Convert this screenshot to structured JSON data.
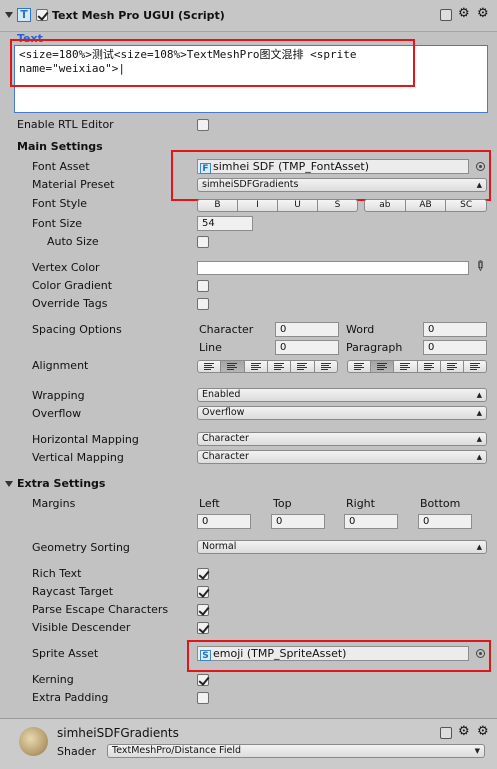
{
  "component": {
    "title": "Text Mesh Pro UGUI (Script)",
    "text_label": "Text",
    "text_value": "<size=180%>测试<size=108%>TextMeshPro图文混排 <sprite\nname=\"weixiao\">|"
  },
  "labels": {
    "enable_rtl": "Enable RTL Editor",
    "main_settings": "Main Settings",
    "font_asset": "Font Asset",
    "material_preset": "Material Preset",
    "font_style": "Font Style",
    "font_size": "Font Size",
    "auto_size": "Auto Size",
    "vertex_color": "Vertex Color",
    "color_gradient": "Color Gradient",
    "override_tags": "Override Tags",
    "spacing_options": "Spacing Options",
    "character": "Character",
    "word": "Word",
    "line": "Line",
    "paragraph": "Paragraph",
    "alignment": "Alignment",
    "wrapping": "Wrapping",
    "overflow": "Overflow",
    "horizontal_mapping": "Horizontal Mapping",
    "vertical_mapping": "Vertical Mapping",
    "extra_settings": "Extra Settings",
    "margins": "Margins",
    "left": "Left",
    "top": "Top",
    "right": "Right",
    "bottom": "Bottom",
    "geometry_sorting": "Geometry Sorting",
    "rich_text": "Rich Text",
    "raycast_target": "Raycast Target",
    "parse_escape": "Parse Escape Characters",
    "visible_descender": "Visible Descender",
    "sprite_asset": "Sprite Asset",
    "kerning": "Kerning",
    "extra_padding": "Extra Padding",
    "shader": "Shader"
  },
  "values": {
    "font_asset": "simhei SDF (TMP_FontAsset)",
    "material_preset": "simheiSDFGradients",
    "font_size": "54",
    "spacing_character": "0",
    "spacing_word": "0",
    "spacing_line": "0",
    "spacing_paragraph": "0",
    "wrapping": "Enabled",
    "overflow": "Overflow",
    "horizontal_mapping": "Character",
    "vertical_mapping": "Character",
    "margin_left": "0",
    "margin_top": "0",
    "margin_right": "0",
    "margin_bottom": "0",
    "geometry_sorting": "Normal",
    "sprite_asset": "emoji (TMP_SpriteAsset)",
    "material_name": "simheiSDFGradients",
    "shader": "TextMeshPro/Distance Field"
  },
  "font_style_buttons": [
    "B",
    "I",
    "U",
    "S",
    "ab",
    "AB",
    "SC"
  ],
  "checkboxes": {
    "enable_rtl": false,
    "auto_size": false,
    "color_gradient": false,
    "override_tags": false,
    "rich_text": true,
    "raycast_target": true,
    "parse_escape": true,
    "visible_descender": true,
    "kerning": true,
    "extra_padding": false,
    "component_enabled": true
  },
  "colors": {
    "panel_bg": "#c2c2c2",
    "highlight_red": "#e0161b",
    "text_label_blue": "#2b5fd6"
  }
}
